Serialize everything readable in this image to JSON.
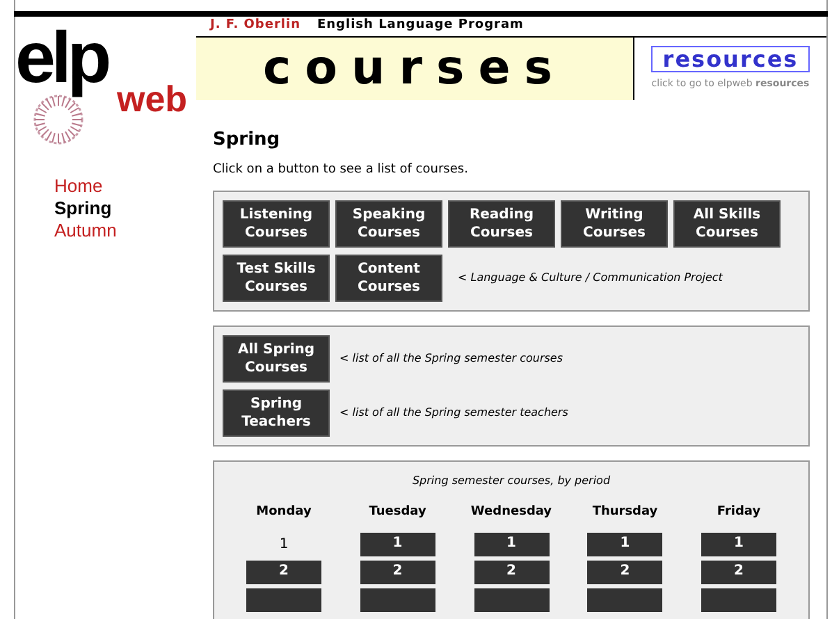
{
  "logo": {
    "main": "elp",
    "sub": "web"
  },
  "header": {
    "school": "J. F. Oberlin",
    "program": "English Language Program",
    "banner": "courses",
    "resources_link": "resources",
    "resources_hint": "click to go to elpweb **resources**"
  },
  "nav": [
    {
      "label": "Home",
      "selected": false
    },
    {
      "label": "Spring",
      "selected": true
    },
    {
      "label": "Autumn",
      "selected": false
    }
  ],
  "page": {
    "title": "Spring",
    "instruction": "Click on a button to see a list of courses."
  },
  "skill_buttons": [
    {
      "label": "Listening Courses"
    },
    {
      "label": "Speaking Courses"
    },
    {
      "label": "Reading Courses"
    },
    {
      "label": "Writing Courses"
    },
    {
      "label": "All Skills Courses"
    },
    {
      "label": "Test Skills Courses"
    },
    {
      "label": "Content Courses"
    }
  ],
  "skill_note": "< Language & Culture / Communication Project",
  "list_rows": [
    {
      "button": "All Spring Courses",
      "note": "< list of all the Spring semester courses"
    },
    {
      "button": "Spring Teachers",
      "note": "< list of all the Spring semester teachers"
    }
  ],
  "schedule": {
    "caption": "Spring semester courses, by period",
    "days": [
      {
        "name": "Monday",
        "periods": [
          {
            "label": "1",
            "kind": "text"
          },
          {
            "label": "2",
            "kind": "button"
          },
          {
            "kind": "button"
          }
        ]
      },
      {
        "name": "Tuesday",
        "periods": [
          {
            "label": "1",
            "kind": "button"
          },
          {
            "label": "2",
            "kind": "button"
          },
          {
            "kind": "button"
          }
        ]
      },
      {
        "name": "Wednesday",
        "periods": [
          {
            "label": "1",
            "kind": "button"
          },
          {
            "label": "2",
            "kind": "button"
          },
          {
            "kind": "button"
          }
        ]
      },
      {
        "name": "Thursday",
        "periods": [
          {
            "label": "1",
            "kind": "button"
          },
          {
            "label": "2",
            "kind": "button"
          },
          {
            "kind": "button"
          }
        ]
      },
      {
        "name": "Friday",
        "periods": [
          {
            "label": "1",
            "kind": "button"
          },
          {
            "label": "2",
            "kind": "button"
          },
          {
            "kind": "button"
          }
        ]
      }
    ]
  }
}
